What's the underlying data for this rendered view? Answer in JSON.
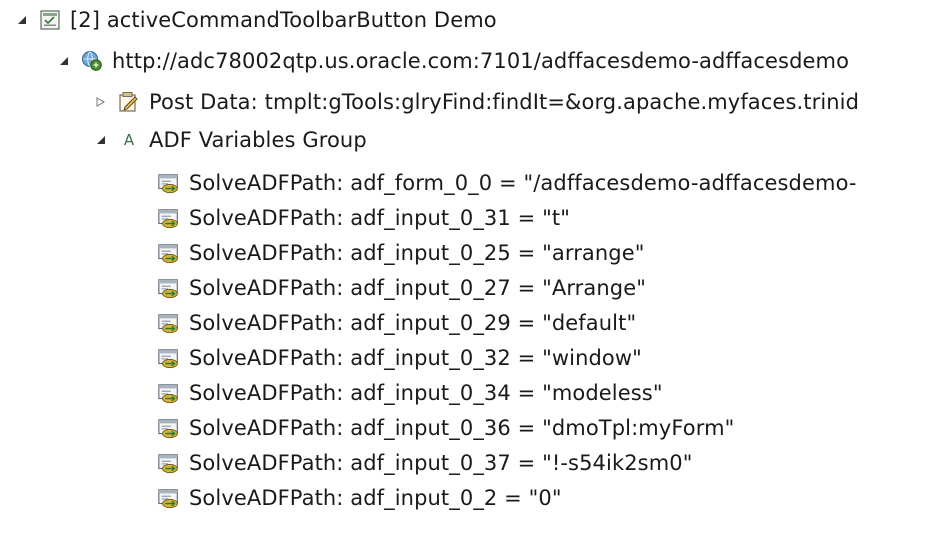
{
  "tree": {
    "root": {
      "label": "[2] activeCommandToolbarButton Demo",
      "icon": "script-step-icon",
      "expanded": true
    },
    "url_node": {
      "label": "http://adc78002qtp.us.oracle.com:7101/adffacesdemo-adffacesdemo",
      "icon": "globe-request-icon",
      "expanded": true
    },
    "post_data": {
      "label": "Post Data: tmplt:gTools:glryFind:findIt=&org.apache.myfaces.trinid",
      "icon": "edit-document-icon",
      "expanded": false
    },
    "variables_group": {
      "label": "ADF Variables Group",
      "icon_text": "A",
      "expanded": true
    },
    "variables": [
      "SolveADFPath: adf_form_0_0 = \"/adffacesdemo-adffacesdemo-",
      "SolveADFPath: adf_input_0_31 = \"t\"",
      "SolveADFPath: adf_input_0_25 = \"arrange\"",
      "SolveADFPath: adf_input_0_27 = \"Arrange\"",
      "SolveADFPath: adf_input_0_29 = \"default\"",
      "SolveADFPath: adf_input_0_32 = \"window\"",
      "SolveADFPath: adf_input_0_34 = \"modeless\"",
      "SolveADFPath: adf_input_0_36 = \"dmoTpl:myForm\"",
      "SolveADFPath: adf_input_0_37 = \"!-s54ik2sm0\"",
      "SolveADFPath: adf_input_0_2 = \"0\""
    ]
  }
}
